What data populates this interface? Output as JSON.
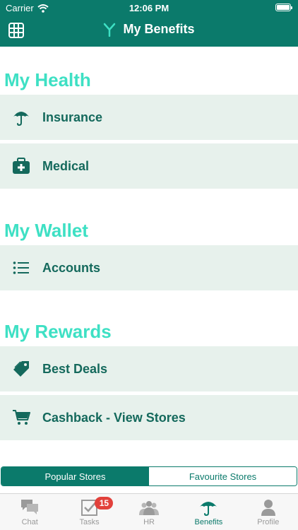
{
  "status_bar": {
    "carrier": "Carrier",
    "time": "12:06 PM"
  },
  "header": {
    "title": "My Benefits",
    "menu_icon": "grid-icon",
    "logo_icon": "y-logo-icon"
  },
  "sections": [
    {
      "title": "My Health",
      "items": [
        {
          "label": "Insurance",
          "icon": "umbrella-icon"
        },
        {
          "label": "Medical",
          "icon": "medkit-icon"
        }
      ]
    },
    {
      "title": "My Wallet",
      "items": [
        {
          "label": "Accounts",
          "icon": "list-icon"
        }
      ]
    },
    {
      "title": "My Rewards",
      "items": [
        {
          "label": "Best Deals",
          "icon": "tag-icon"
        },
        {
          "label": "Cashback - View Stores",
          "icon": "cart-icon"
        }
      ]
    }
  ],
  "store_tabs": {
    "popular": "Popular Stores",
    "favourite": "Favourite Stores",
    "selected": "Popular Stores"
  },
  "tabbar": {
    "chat": "Chat",
    "tasks": "Tasks",
    "tasks_badge": "15",
    "hr": "HR",
    "benefits": "Benefits",
    "profile": "Profile",
    "active": "Benefits"
  },
  "colors": {
    "brand": "#0b7a6b",
    "section_title": "#3ee0c4",
    "row_bg": "#e7f1ec",
    "badge": "#e2413b"
  }
}
